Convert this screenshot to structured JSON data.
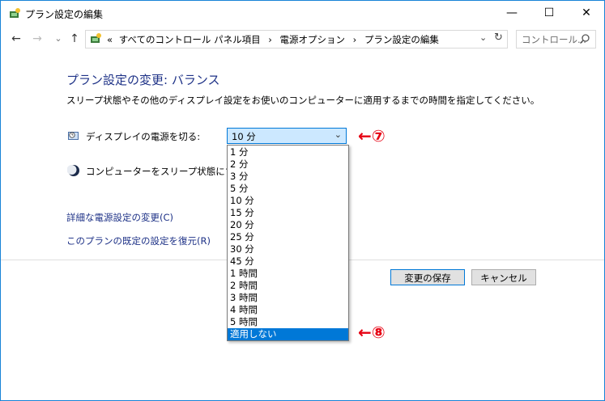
{
  "window": {
    "title": "プラン設定の編集",
    "minimize": "—",
    "maximize": "☐",
    "close": "✕"
  },
  "nav": {
    "back": "←",
    "forward": "→",
    "recent": "⌄",
    "up": "↑"
  },
  "address": {
    "prefix": "«",
    "crumbs": [
      "すべてのコントロール パネル項目",
      "電源オプション",
      "プラン設定の編集"
    ],
    "separator": "›"
  },
  "search": {
    "placeholder": "コントロール..."
  },
  "content": {
    "heading": "プラン設定の変更: バランス",
    "description": "スリープ状態やその他のディスプレイ設定をお使いのコンピューターに適用するまでの時間を指定してください。",
    "display_off_label": "ディスプレイの電源を切る:",
    "sleep_label": "コンピューターをスリープ状態にする:",
    "display_off_value": "10 分",
    "options": [
      "1 分",
      "2 分",
      "3 分",
      "5 分",
      "10 分",
      "15 分",
      "20 分",
      "25 分",
      "30 分",
      "45 分",
      "1 時間",
      "2 時間",
      "3 時間",
      "4 時間",
      "5 時間",
      "適用しない"
    ],
    "highlighted_option": "適用しない",
    "link_advanced": "詳細な電源設定の変更(C)",
    "link_restore": "このプランの既定の設定を復元(R)",
    "save_button": "変更の保存",
    "cancel_button": "キャンセル"
  },
  "annotations": {
    "a7": "←⑦",
    "a8": "←⑧"
  },
  "colors": {
    "accent": "#0078d7",
    "link": "#1e3287",
    "annotation": "#e60012"
  }
}
